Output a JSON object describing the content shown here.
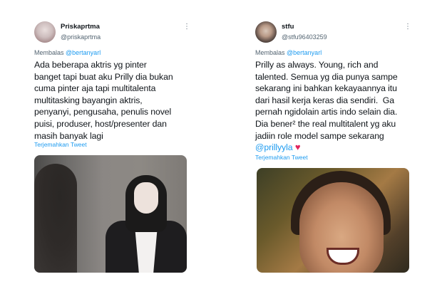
{
  "tweets": [
    {
      "display_name": "Priskaprtma",
      "handle": "@priskaprtma",
      "reply_prefix": "Membalas",
      "reply_to": "@bertanyarl",
      "body": "Ada beberapa aktris yg pinter\nbanget tapi buat aku Prilly dia bukan\ncuma pinter aja tapi multitalenta\nmultitasking bayangin aktris,\npenyanyi, pengusaha, penulis novel\npuisi, produser, host/presenter dan\nmasih banyak lagi",
      "translate": "Terjemahkan Tweet",
      "more_icon": "more-dots-icon"
    },
    {
      "display_name": "stfu",
      "handle": "@stfu96403259",
      "reply_prefix": "Membalas",
      "reply_to": "@bertanyarl",
      "body": "Prilly as always. Young, rich and\ntalented. Semua yg dia punya sampe\nsekarang ini bahkan kekayaannya itu\ndari hasil kerja keras dia sendiri.  Ga\npernah ngidolain artis indo selain dia.\nDia bener² the real multitalent yg aku\njadiin role model sampe sekarang\n",
      "body_mention": "@prillyyla",
      "heart": "♥",
      "translate": "Terjemahkan Tweet",
      "more_icon": "more-dots-icon"
    }
  ],
  "colors": {
    "link": "#1d9bf0",
    "secondary": "#536471",
    "heart": "#e0245e"
  }
}
